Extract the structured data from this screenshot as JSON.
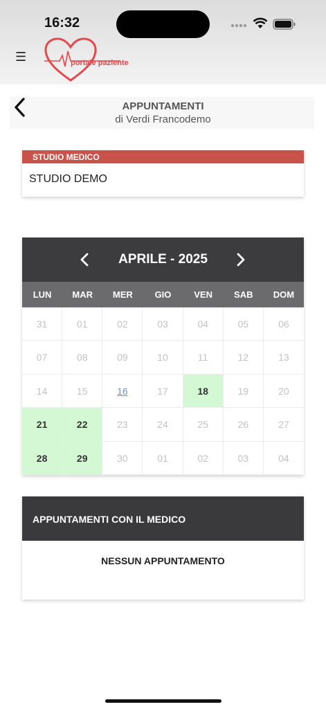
{
  "status_bar": {
    "time": "16:32"
  },
  "header": {
    "logo_text": "portale paziente",
    "brand_color": "#e5484d"
  },
  "page": {
    "title": "APPUNTAMENTI",
    "subtitle": "di Verdi Francodemo"
  },
  "studio": {
    "label": "STUDIO MEDICO",
    "name": "STUDIO DEMO",
    "accent_color": "#c9524a"
  },
  "calendar": {
    "month": "APRILE - 2025",
    "weekdays": [
      "LUN",
      "MAR",
      "MER",
      "GIO",
      "VEN",
      "SAB",
      "DOM"
    ],
    "days": [
      {
        "label": "31",
        "state": "inactive"
      },
      {
        "label": "01",
        "state": "inactive"
      },
      {
        "label": "02",
        "state": "inactive"
      },
      {
        "label": "03",
        "state": "inactive"
      },
      {
        "label": "04",
        "state": "inactive"
      },
      {
        "label": "05",
        "state": "inactive"
      },
      {
        "label": "06",
        "state": "inactive"
      },
      {
        "label": "07",
        "state": "inactive"
      },
      {
        "label": "08",
        "state": "inactive"
      },
      {
        "label": "09",
        "state": "inactive"
      },
      {
        "label": "10",
        "state": "inactive"
      },
      {
        "label": "11",
        "state": "inactive"
      },
      {
        "label": "12",
        "state": "inactive"
      },
      {
        "label": "13",
        "state": "inactive"
      },
      {
        "label": "14",
        "state": "inactive"
      },
      {
        "label": "15",
        "state": "inactive"
      },
      {
        "label": "16",
        "state": "today"
      },
      {
        "label": "17",
        "state": "inactive"
      },
      {
        "label": "18",
        "state": "available"
      },
      {
        "label": "19",
        "state": "inactive"
      },
      {
        "label": "20",
        "state": "inactive"
      },
      {
        "label": "21",
        "state": "available"
      },
      {
        "label": "22",
        "state": "available"
      },
      {
        "label": "23",
        "state": "inactive"
      },
      {
        "label": "24",
        "state": "inactive"
      },
      {
        "label": "25",
        "state": "inactive"
      },
      {
        "label": "26",
        "state": "inactive"
      },
      {
        "label": "27",
        "state": "inactive"
      },
      {
        "label": "28",
        "state": "available"
      },
      {
        "label": "29",
        "state": "available"
      },
      {
        "label": "30",
        "state": "inactive"
      },
      {
        "label": "01",
        "state": "inactive"
      },
      {
        "label": "02",
        "state": "inactive"
      },
      {
        "label": "03",
        "state": "inactive"
      },
      {
        "label": "04",
        "state": "inactive"
      }
    ],
    "available_color": "#d4f7d4"
  },
  "appointments": {
    "header": "APPUNTAMENTI CON IL MEDICO",
    "empty_text": "NESSUN APPUNTAMENTO"
  }
}
